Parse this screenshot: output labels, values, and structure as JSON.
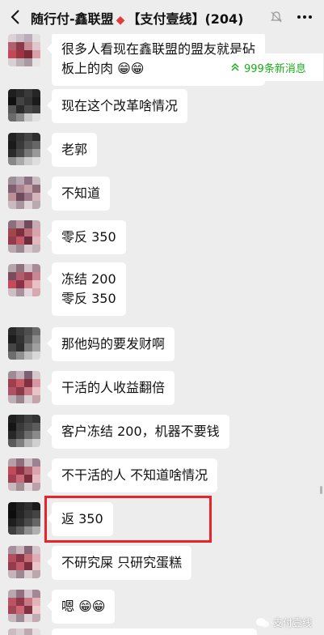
{
  "header": {
    "title_left": "随行付-鑫联盟",
    "title_diamond": "◆",
    "title_right": "【支付壹线】(204)"
  },
  "new_messages": {
    "label": "999条新消息"
  },
  "messages": [
    {
      "text": "很多人看现在鑫联盟的盟友就是砧\n板上的肉 😁😁"
    },
    {
      "text": "现在这个改革啥情况"
    },
    {
      "text": "老郭"
    },
    {
      "text": "不知道"
    },
    {
      "text": "零反 350"
    },
    {
      "text": "冻结 200\n零反 350"
    },
    {
      "text": "那他妈的要发财啊"
    },
    {
      "text": "干活的人收益翻倍"
    },
    {
      "text": "客户冻结 200，机器不要钱"
    },
    {
      "text": "不干活的人  不知道啥情况"
    },
    {
      "text": "返 350"
    },
    {
      "text": "不研究屎  只研究蛋糕"
    },
    {
      "text": "嗯 😁😁"
    }
  ],
  "watermark": {
    "label": "支付壹线"
  },
  "colors": {
    "background": "#ededed",
    "bubble": "#ffffff",
    "accent_green": "#1aad19",
    "highlight_red": "#e8232a"
  }
}
